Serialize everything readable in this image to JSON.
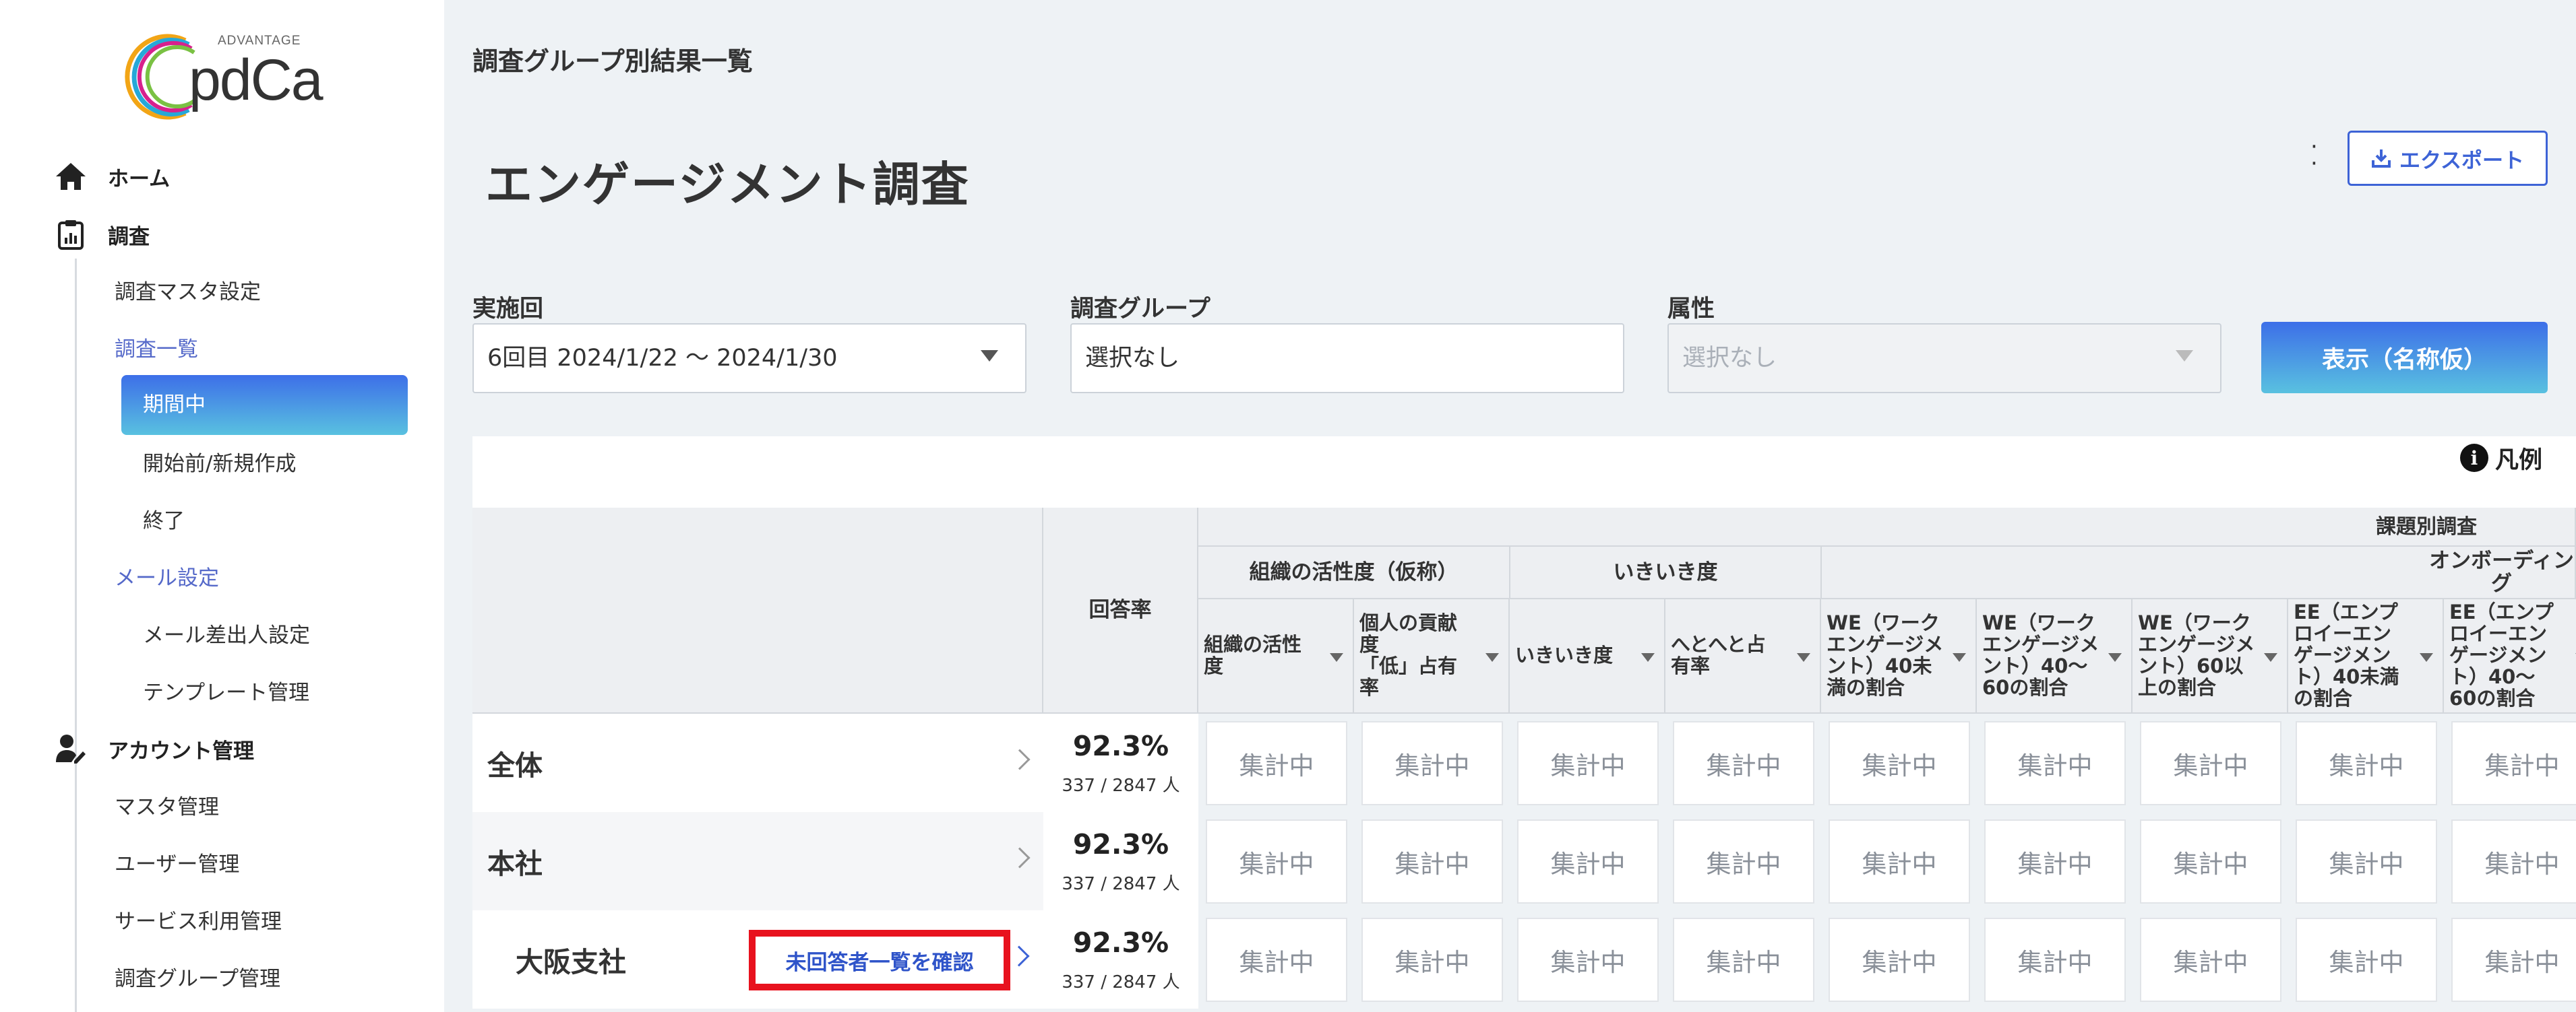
{
  "logo": {
    "brand": "pdCa",
    "tagline": "ADVANTAGE"
  },
  "sidebar": {
    "home": "ホーム",
    "survey": "調査",
    "survey_master": "調査マスタ設定",
    "survey_list": "調査一覧",
    "in_progress": "期間中",
    "before_start": "開始前/新規作成",
    "finished": "終了",
    "mail_settings": "メール設定",
    "mail_sender": "メール差出人設定",
    "template": "テンプレート管理",
    "account": "アカウント管理",
    "master": "マスタ管理",
    "users": "ユーザー管理",
    "service": "サービス利用管理",
    "survey_group": "調査グループ管理"
  },
  "header": {
    "breadcrumb": "調査グループ別結果一覧",
    "title": "エンゲージメント調査",
    "export": "エクスポート"
  },
  "filters": {
    "round_label": "実施回",
    "round_value": "6回目  2024/1/22 〜 2024/1/30",
    "group_label": "調査グループ",
    "group_value": "選択なし",
    "attr_label": "属性",
    "attr_value": "選択なし",
    "show_button": "表示（名称仮）"
  },
  "legend": "凡例",
  "table": {
    "response_rate_header": "回答率",
    "top_group_header": "課題別調査",
    "groups": [
      "組織の活性度（仮称）",
      "いきいき度",
      "オンボーディング"
    ],
    "columns": [
      {
        "lines": [
          "組織の活性",
          "度"
        ]
      },
      {
        "lines": [
          "個人の貢献",
          "度",
          "「低」占有",
          "率"
        ]
      },
      {
        "lines": [
          "いきいき度"
        ]
      },
      {
        "lines": [
          "へとへと占",
          "有率"
        ]
      },
      {
        "lines": [
          "WE（ワーク",
          "エンゲージメ",
          "ント）40未",
          "満の割合"
        ]
      },
      {
        "lines": [
          "WE（ワーク",
          "エンゲージメ",
          "ント）40〜",
          "60の割合"
        ]
      },
      {
        "lines": [
          "WE（ワーク",
          "エンゲージメ",
          "ント）60以",
          "上の割合"
        ]
      },
      {
        "lines": [
          "EE（エンプ",
          "ロイーエン",
          "ゲージメン",
          "ト）40未満",
          "の割合"
        ]
      },
      {
        "lines": [
          "EE（エンプ",
          "ロイーエン",
          "ゲージメン",
          "ト）40〜",
          "60の割合"
        ]
      }
    ],
    "rows": [
      {
        "name": "全体",
        "rate": "92.3%",
        "count": "337 / 2847 人"
      },
      {
        "name": "本社",
        "rate": "92.3%",
        "count": "337 / 2847 人"
      },
      {
        "name": "大阪支社",
        "rate": "92.3%",
        "count": "337 / 2847 人",
        "action": "未回答者一覧を確認"
      }
    ],
    "cell_value": "集計中"
  }
}
